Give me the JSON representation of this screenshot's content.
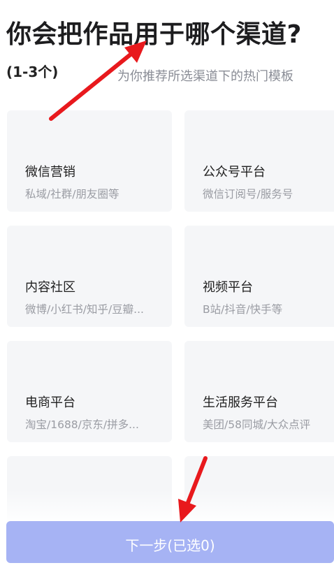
{
  "header": {
    "title": "你会把作品用于哪个渠道?",
    "count_hint": "(1-3个)",
    "subtitle": "为你推荐所选渠道下的热门模板"
  },
  "channels": [
    {
      "title": "微信营销",
      "desc": "私域/社群/朋友圈等"
    },
    {
      "title": "公众号平台",
      "desc": "微信订阅号/服务号"
    },
    {
      "title": "内容社区",
      "desc": "微博/小红书/知乎/豆瓣..."
    },
    {
      "title": "视频平台",
      "desc": "B站/抖音/快手等"
    },
    {
      "title": "电商平台",
      "desc": "淘宝/1688/京东/拼多..."
    },
    {
      "title": "生活服务平台",
      "desc": "美团/58同城/大众点评"
    },
    {
      "title": "",
      "desc": ""
    },
    {
      "title": "",
      "desc": ""
    }
  ],
  "footer": {
    "next_label": "下一步(已选0)"
  },
  "colors": {
    "accent_button": "#a6b3f4",
    "card_bg": "#f5f6f8",
    "annotation_arrow": "#e8191d"
  }
}
